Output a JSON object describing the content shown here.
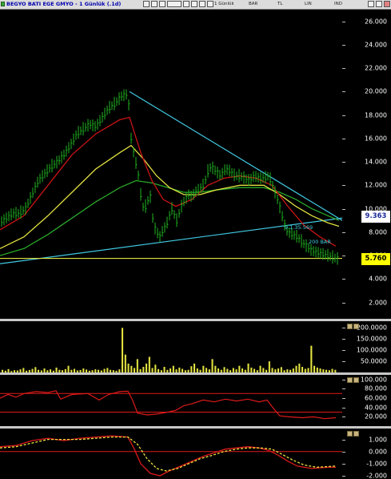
{
  "window": {
    "title": "BEGYO BATI EGE GMYO - 1 Günlük (.1d)",
    "toolbar": {
      "timeframe": "1 Günlük",
      "chart_type": "BAR",
      "currency": "TL",
      "scale": "LIN",
      "indicator": "IND"
    }
  },
  "colors": {
    "background": "#000000",
    "price_bars": "#1fb51f",
    "ma_red": "#c81414",
    "ma_yellow": "#e0e040",
    "ma_green": "#2aa82a",
    "trendline": "#40c8e0",
    "support": "#e0e040",
    "volume": "#e0e040",
    "osc_red": "#dd1a1a",
    "macd_yellow": "#f0e040"
  },
  "badges": {
    "trend_value": "9.363",
    "support_value": "5.760"
  },
  "annotations": {
    "ma_label_1": "9.1.35.569",
    "ma_label_2": "200 BAR"
  },
  "chart_data": [
    {
      "type": "candlestick",
      "ylim": [
        0.6,
        27.0
      ],
      "yticks": [
        "2.000",
        "4.000",
        "6.000",
        "8.000",
        "10.000",
        "12.000",
        "14.000",
        "16.000",
        "18.000",
        "20.000",
        "22.000",
        "24.000",
        "26.000"
      ],
      "close_series": [
        [
          0,
          8.8
        ],
        [
          8,
          9.2
        ],
        [
          16,
          9.6
        ],
        [
          24,
          9.6
        ],
        [
          32,
          10.0
        ],
        [
          40,
          11.2
        ],
        [
          48,
          12.4
        ],
        [
          56,
          13.0
        ],
        [
          64,
          13.6
        ],
        [
          72,
          14.0
        ],
        [
          80,
          14.6
        ],
        [
          88,
          15.4
        ],
        [
          96,
          16.4
        ],
        [
          104,
          16.8
        ],
        [
          112,
          17.2
        ],
        [
          120,
          17.0
        ],
        [
          128,
          17.8
        ],
        [
          136,
          18.6
        ],
        [
          144,
          19.0
        ],
        [
          152,
          19.6
        ],
        [
          160,
          19.8
        ],
        [
          164,
          16.0
        ],
        [
          168,
          14.4
        ],
        [
          172,
          13.4
        ],
        [
          176,
          11.2
        ],
        [
          180,
          9.8
        ],
        [
          184,
          10.6
        ],
        [
          188,
          11.0
        ],
        [
          192,
          8.6
        ],
        [
          196,
          8.0
        ],
        [
          200,
          7.6
        ],
        [
          204,
          8.2
        ],
        [
          208,
          8.6
        ],
        [
          212,
          9.4
        ],
        [
          216,
          10.2
        ],
        [
          220,
          8.8
        ],
        [
          224,
          9.6
        ],
        [
          228,
          10.4
        ],
        [
          232,
          10.8
        ],
        [
          236,
          11.2
        ],
        [
          240,
          11.0
        ],
        [
          244,
          11.4
        ],
        [
          248,
          11.6
        ],
        [
          252,
          11.8
        ],
        [
          256,
          12.2
        ],
        [
          260,
          13.2
        ],
        [
          264,
          13.6
        ],
        [
          270,
          13.2
        ],
        [
          276,
          12.8
        ],
        [
          282,
          13.4
        ],
        [
          288,
          13.2
        ],
        [
          294,
          12.8
        ],
        [
          300,
          12.8
        ],
        [
          306,
          12.6
        ],
        [
          312,
          12.4
        ],
        [
          318,
          12.8
        ],
        [
          324,
          12.6
        ],
        [
          330,
          12.6
        ],
        [
          336,
          12.8
        ],
        [
          340,
          12.2
        ],
        [
          344,
          11.4
        ],
        [
          348,
          10.6
        ],
        [
          352,
          9.6
        ],
        [
          356,
          8.6
        ],
        [
          360,
          8.0
        ],
        [
          366,
          7.8
        ],
        [
          372,
          7.6
        ],
        [
          380,
          7.0
        ],
        [
          390,
          6.4
        ],
        [
          400,
          6.2
        ],
        [
          410,
          6.0
        ],
        [
          418,
          5.8
        ],
        [
          424,
          5.7
        ]
      ],
      "moving_averages": {
        "red": [
          [
            0,
            8.2
          ],
          [
            30,
            9.4
          ],
          [
            60,
            12.0
          ],
          [
            90,
            14.6
          ],
          [
            120,
            16.4
          ],
          [
            150,
            17.6
          ],
          [
            162,
            17.8
          ],
          [
            176,
            14.8
          ],
          [
            190,
            12.4
          ],
          [
            204,
            10.8
          ],
          [
            220,
            10.2
          ],
          [
            240,
            10.8
          ],
          [
            260,
            12.0
          ],
          [
            280,
            12.6
          ],
          [
            300,
            12.8
          ],
          [
            320,
            12.6
          ],
          [
            340,
            12.0
          ],
          [
            360,
            10.2
          ],
          [
            380,
            8.6
          ],
          [
            400,
            7.6
          ],
          [
            420,
            6.8
          ]
        ],
        "yellow": [
          [
            0,
            6.6
          ],
          [
            30,
            7.6
          ],
          [
            60,
            9.4
          ],
          [
            90,
            11.4
          ],
          [
            120,
            13.4
          ],
          [
            150,
            14.8
          ],
          [
            164,
            15.4
          ],
          [
            180,
            14.2
          ],
          [
            196,
            12.8
          ],
          [
            212,
            11.8
          ],
          [
            230,
            11.2
          ],
          [
            250,
            11.2
          ],
          [
            270,
            11.6
          ],
          [
            300,
            12.0
          ],
          [
            330,
            12.0
          ],
          [
            350,
            11.2
          ],
          [
            370,
            10.2
          ],
          [
            390,
            9.4
          ],
          [
            410,
            8.8
          ],
          [
            424,
            8.5
          ]
        ],
        "green": [
          [
            0,
            6.0
          ],
          [
            30,
            6.6
          ],
          [
            60,
            7.8
          ],
          [
            90,
            9.2
          ],
          [
            120,
            10.6
          ],
          [
            150,
            11.8
          ],
          [
            170,
            12.4
          ],
          [
            190,
            12.2
          ],
          [
            210,
            11.8
          ],
          [
            230,
            11.4
          ],
          [
            250,
            11.4
          ],
          [
            270,
            11.6
          ],
          [
            300,
            11.8
          ],
          [
            330,
            11.8
          ],
          [
            350,
            11.4
          ],
          [
            370,
            10.8
          ],
          [
            390,
            10.0
          ],
          [
            410,
            9.4
          ],
          [
            424,
            9.0
          ]
        ]
      },
      "trendlines": [
        {
          "from": [
            162,
            20.0
          ],
          "to": [
            428,
            9.0
          ]
        },
        {
          "from": [
            0,
            5.3
          ],
          "to": [
            428,
            9.2
          ]
        },
        {
          "from": [
            0,
            5.76
          ],
          "to": [
            428,
            5.76
          ]
        }
      ]
    },
    {
      "type": "bar",
      "name": "volume",
      "ylim": [
        0,
        230
      ],
      "yticks": [
        "50.0000",
        "100.0000",
        "150.0000",
        "200.0000"
      ],
      "values": [
        12,
        8,
        15,
        6,
        10,
        9,
        14,
        20,
        8,
        11,
        16,
        24,
        12,
        9,
        18,
        10,
        14,
        8,
        22,
        12,
        10,
        15,
        30,
        12,
        16,
        9,
        11,
        18,
        13,
        8,
        10,
        14,
        12,
        9,
        16,
        20,
        12,
        10,
        8,
        14,
        200,
        80,
        40,
        30,
        20,
        60,
        15,
        25,
        40,
        70,
        20,
        35,
        15,
        10,
        25,
        12,
        18,
        30,
        14,
        22,
        16,
        10,
        12,
        28,
        40,
        18,
        12,
        30,
        20,
        14,
        60,
        30,
        18,
        12,
        24,
        16,
        10,
        20,
        14,
        30,
        18,
        12,
        40,
        22,
        16,
        10,
        30,
        20,
        12,
        50,
        20,
        14,
        18,
        24,
        10,
        14,
        12,
        18,
        30,
        40,
        25,
        16,
        20,
        120,
        30,
        22,
        18,
        14,
        12,
        10,
        16,
        12
      ]
    },
    {
      "type": "line",
      "name": "oscillator",
      "ylim": [
        0,
        110
      ],
      "yticks": [
        "20.000",
        "40.000",
        "60.000",
        "80.000",
        "100.000"
      ],
      "levels": [
        30,
        70
      ],
      "values": [
        [
          0,
          60
        ],
        [
          10,
          68
        ],
        [
          20,
          62
        ],
        [
          30,
          70
        ],
        [
          45,
          74
        ],
        [
          60,
          72
        ],
        [
          70,
          76
        ],
        [
          76,
          58
        ],
        [
          90,
          68
        ],
        [
          110,
          70
        ],
        [
          124,
          56
        ],
        [
          136,
          68
        ],
        [
          150,
          74
        ],
        [
          160,
          75
        ],
        [
          166,
          55
        ],
        [
          172,
          28
        ],
        [
          184,
          24
        ],
        [
          196,
          26
        ],
        [
          210,
          30
        ],
        [
          220,
          34
        ],
        [
          230,
          44
        ],
        [
          240,
          48
        ],
        [
          254,
          56
        ],
        [
          268,
          52
        ],
        [
          282,
          58
        ],
        [
          296,
          54
        ],
        [
          310,
          58
        ],
        [
          324,
          52
        ],
        [
          334,
          56
        ],
        [
          342,
          38
        ],
        [
          350,
          22
        ],
        [
          362,
          20
        ],
        [
          378,
          18
        ],
        [
          392,
          20
        ],
        [
          406,
          16
        ],
        [
          420,
          18
        ]
      ]
    },
    {
      "type": "line",
      "name": "macd",
      "ylim": [
        -2.2,
        1.9
      ],
      "yticks": [
        "-2.000",
        "-1.000",
        "0.000",
        "1.000"
      ],
      "levels": [
        0
      ],
      "values": [
        [
          0,
          0.4
        ],
        [
          20,
          0.5
        ],
        [
          40,
          0.9
        ],
        [
          60,
          1.1
        ],
        [
          80,
          0.9
        ],
        [
          100,
          1.1
        ],
        [
          120,
          1.2
        ],
        [
          140,
          1.3
        ],
        [
          160,
          1.2
        ],
        [
          168,
          0.2
        ],
        [
          176,
          -1.0
        ],
        [
          188,
          -1.8
        ],
        [
          200,
          -2.0
        ],
        [
          212,
          -1.6
        ],
        [
          226,
          -1.2
        ],
        [
          240,
          -0.8
        ],
        [
          254,
          -0.4
        ],
        [
          268,
          -0.1
        ],
        [
          282,
          0.2
        ],
        [
          296,
          0.3
        ],
        [
          310,
          0.4
        ],
        [
          324,
          0.3
        ],
        [
          336,
          0.1
        ],
        [
          348,
          -0.3
        ],
        [
          360,
          -0.8
        ],
        [
          372,
          -1.2
        ],
        [
          390,
          -1.4
        ],
        [
          410,
          -1.3
        ],
        [
          420,
          -1.3
        ]
      ],
      "signal": [
        [
          0,
          0.3
        ],
        [
          20,
          0.4
        ],
        [
          40,
          0.7
        ],
        [
          60,
          1.0
        ],
        [
          80,
          1.0
        ],
        [
          100,
          1.0
        ],
        [
          120,
          1.1
        ],
        [
          140,
          1.2
        ],
        [
          160,
          1.2
        ],
        [
          172,
          0.6
        ],
        [
          184,
          -0.6
        ],
        [
          196,
          -1.4
        ],
        [
          208,
          -1.6
        ],
        [
          222,
          -1.4
        ],
        [
          236,
          -1.0
        ],
        [
          250,
          -0.6
        ],
        [
          266,
          -0.3
        ],
        [
          280,
          0.0
        ],
        [
          296,
          0.2
        ],
        [
          310,
          0.3
        ],
        [
          326,
          0.3
        ],
        [
          340,
          0.2
        ],
        [
          352,
          -0.2
        ],
        [
          366,
          -0.7
        ],
        [
          380,
          -1.1
        ],
        [
          396,
          -1.3
        ],
        [
          420,
          -1.2
        ]
      ]
    }
  ]
}
